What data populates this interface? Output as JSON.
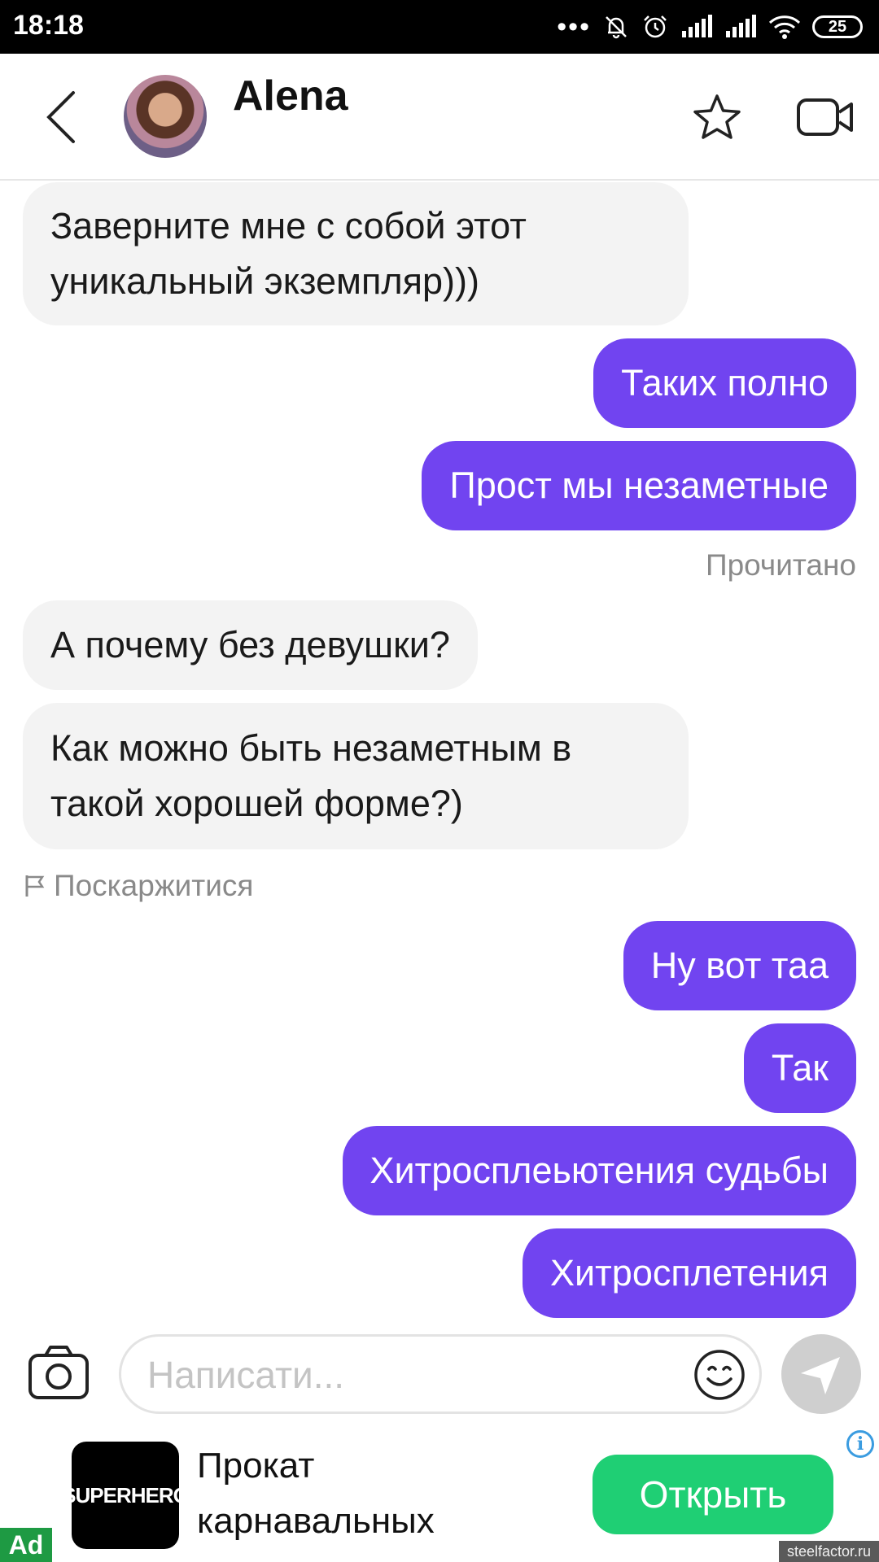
{
  "status_bar": {
    "time": "18:18",
    "dots": "•••",
    "battery": "25"
  },
  "header": {
    "contact_name": "Alena"
  },
  "messages": [
    {
      "dir": "in",
      "text": "Заверните мне с собой этот уникальный экземпляр)))"
    },
    {
      "dir": "out",
      "text": "Таких полно"
    },
    {
      "dir": "out",
      "text": "Прост мы незаметные"
    },
    {
      "dir": "in",
      "text": "А почему без девушки?"
    },
    {
      "dir": "in",
      "text": "Как можно быть незаметным в такой хорошей форме?)"
    },
    {
      "dir": "out",
      "text": "Ну вот таа"
    },
    {
      "dir": "out",
      "text": "Так"
    },
    {
      "dir": "out",
      "text": "Хитросплеьютения судьбы"
    },
    {
      "dir": "out",
      "text": "Хитросплетения"
    }
  ],
  "read_status": "Прочитано",
  "report_link": "Поскаржитися",
  "composer": {
    "placeholder": "Написати...",
    "value": ""
  },
  "ad": {
    "brand": "SUPERHERO",
    "title": "Прокат карнавальных",
    "cta": "Открыть",
    "info": "i",
    "badge": "Ad"
  },
  "watermark": "steelfactor.ru",
  "colors": {
    "outgoing_bubble": "#7144f0",
    "incoming_bubble": "#f3f3f3",
    "cta": "#1fcf74"
  }
}
